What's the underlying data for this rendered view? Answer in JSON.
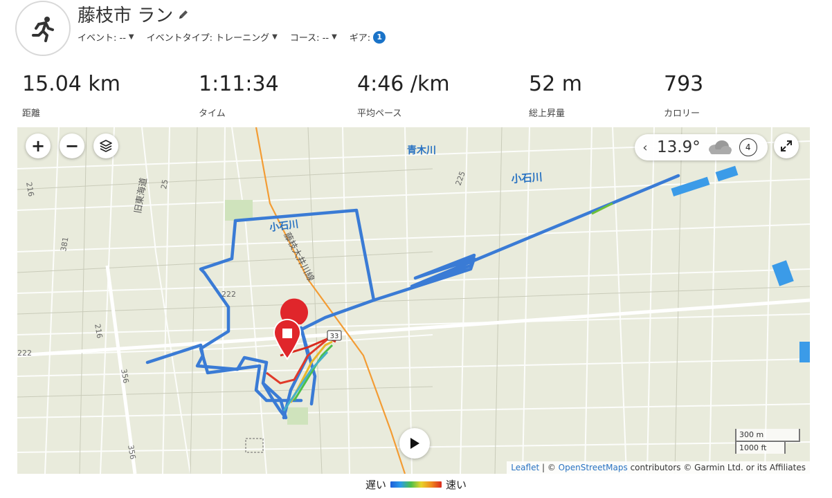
{
  "header": {
    "title": "藤枝市 ラン",
    "meta": [
      {
        "label": "イベント: --"
      },
      {
        "label": "イベントタイプ: トレーニング"
      },
      {
        "label": "コース: --"
      },
      {
        "label": "ギア:"
      }
    ],
    "gear_count": "1"
  },
  "stats": [
    {
      "value": "15.04 km",
      "label": "距離"
    },
    {
      "value": "1:11:34",
      "label": "タイム"
    },
    {
      "value": "4:46 /km",
      "label": "平均ペース"
    },
    {
      "value": "52 m",
      "label": "総上昇量"
    },
    {
      "value": "793",
      "label": "カロリー"
    }
  ],
  "map": {
    "zoom_in": "+",
    "zoom_out": "−",
    "weather": {
      "temp": "13.9°",
      "wind": "4"
    },
    "labels": {
      "river1": "青木川",
      "river2": "小石川",
      "river3": "小石川",
      "rail": "藤枝大井川線",
      "old_road": "旧東海道",
      "route33": "33",
      "r381": "381",
      "r222a": "222",
      "r222b": "222",
      "r216": "216",
      "r216b": "216",
      "r356": "356",
      "r356b": "356",
      "r25": "25",
      "r225": "225"
    },
    "scale": {
      "metric": "300 m",
      "imperial": "1000 ft"
    },
    "attribution": {
      "leaflet": "Leaflet",
      "sep": " | © ",
      "osm": "OpenStreetMaps",
      "rest": " contributors © Garmin Ltd. or its Affiliates"
    },
    "colors": {
      "background": "#e9ebdc",
      "route": "#3a7bd5",
      "rail": "#f39c34",
      "water": "#3b9be8",
      "start": "#3aa33a",
      "end": "#e0262b"
    }
  },
  "legend": {
    "slow": "遅い",
    "fast": "速い"
  }
}
